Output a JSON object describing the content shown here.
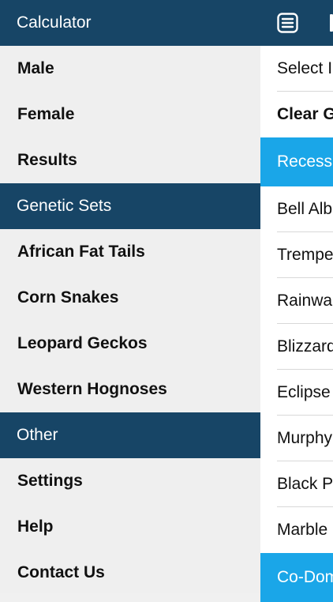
{
  "drawer": {
    "sections": [
      {
        "header": "Calculator",
        "items": [
          "Male",
          "Female",
          "Results"
        ]
      },
      {
        "header": "Genetic Sets",
        "items": [
          "African Fat Tails",
          "Corn Snakes",
          "Leopard Geckos",
          "Western Hognoses"
        ]
      },
      {
        "header": "Other",
        "items": [
          "Settings",
          "Help",
          "Contact Us"
        ]
      }
    ]
  },
  "main": {
    "menu_icon": "hamburger-list-icon",
    "actions": [
      "Select I",
      "Clear G"
    ],
    "category1": "Recess",
    "genes": [
      "Bell Alb",
      "Trempe",
      "Rainwa",
      "Blizzard",
      "Eclipse",
      "Murphy",
      "Black P",
      "Marble"
    ],
    "category2": "Co-Dom"
  },
  "colors": {
    "header_bg": "#174566",
    "category_bg": "#1aa6e8",
    "drawer_bg": "#efefef"
  }
}
